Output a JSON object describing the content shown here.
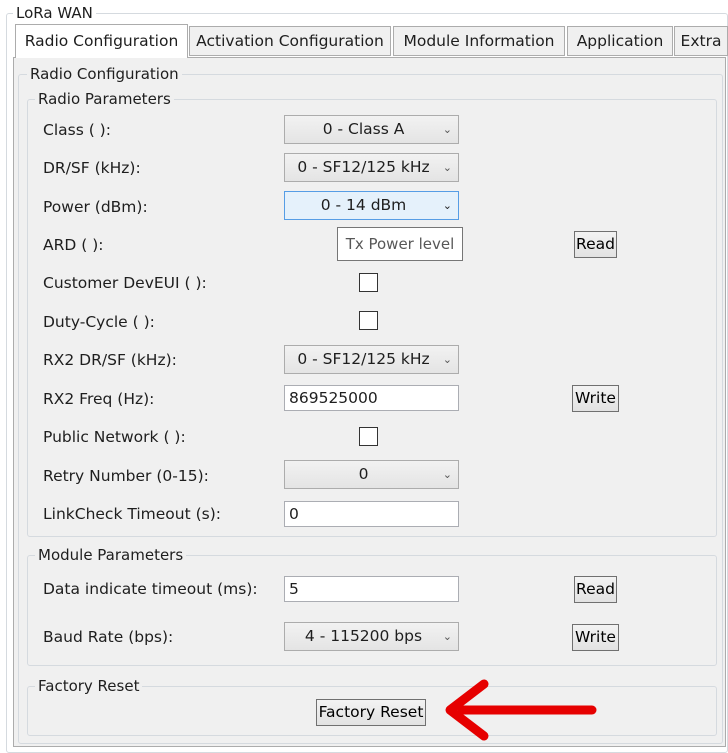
{
  "window": {
    "group_title": "LoRa WAN"
  },
  "tabs": [
    {
      "label": "Radio Configuration",
      "active": true
    },
    {
      "label": "Activation Configuration",
      "active": false
    },
    {
      "label": "Module Information",
      "active": false
    },
    {
      "label": "Application",
      "active": false
    },
    {
      "label": "Extra",
      "active": false
    }
  ],
  "radio_configuration": {
    "title": "Radio Configuration",
    "radio_parameters": {
      "title": "Radio Parameters",
      "class": {
        "label": "Class ( ):",
        "value": "0 - Class A"
      },
      "dr_sf": {
        "label": "DR/SF (kHz):",
        "value": "0 - SF12/125 kHz"
      },
      "power": {
        "label": "Power (dBm):",
        "value": "0 - 14 dBm",
        "tooltip": "Tx Power level"
      },
      "ard": {
        "label": "ARD ( ):",
        "button": "Read"
      },
      "customer_deveui": {
        "label": "Customer DevEUI ( ):",
        "checked": false
      },
      "duty_cycle": {
        "label": "Duty-Cycle ( ):",
        "checked": false
      },
      "rx2_dr_sf": {
        "label": "RX2 DR/SF (kHz):",
        "value": "0 - SF12/125 kHz"
      },
      "rx2_freq": {
        "label": "RX2 Freq (Hz):",
        "value": "869525000",
        "button": "Write"
      },
      "public_network": {
        "label": "Public Network ( ):",
        "checked": false
      },
      "retry_number": {
        "label": "Retry Number (0-15):",
        "value": "0"
      },
      "linkcheck_timeout": {
        "label": "LinkCheck Timeout (s):",
        "value": "0"
      }
    },
    "module_parameters": {
      "title": "Module Parameters",
      "data_indicate_timeout": {
        "label": "Data indicate timeout (ms):",
        "value": "5",
        "button": "Read"
      },
      "baud_rate": {
        "label": "Baud Rate (bps):",
        "value": "4 - 115200 bps",
        "button": "Write"
      }
    },
    "factory_reset": {
      "title": "Factory Reset",
      "button": "Factory Reset"
    }
  },
  "annotation": {
    "arrow_color": "#e60000"
  },
  "colors": {
    "panel_bg": "#f0f0f0",
    "focus_border": "#569de5",
    "focus_bg": "#e5f1fb"
  }
}
